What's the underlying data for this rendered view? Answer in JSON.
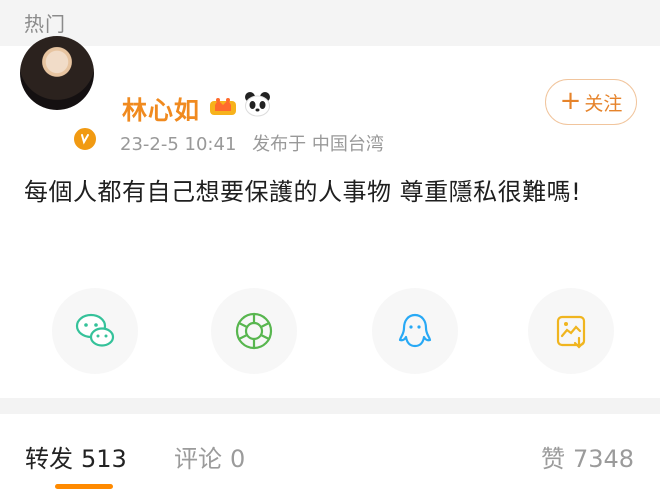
{
  "top": {
    "title": "热门"
  },
  "post": {
    "username": "林心如",
    "date": "23-2-5 10:41",
    "location": "发布于 中国台湾",
    "text": "每個人都有自己想要保護的人事物 尊重隱私很難嗎!",
    "follow_label": "关注"
  },
  "share_icons": [
    "wechat-icon",
    "moments-icon",
    "qq-icon",
    "save-image-icon"
  ],
  "stats": {
    "repost_label": "转发",
    "repost_count": "513",
    "comment_label": "评论",
    "comment_count": "0",
    "like_label": "赞",
    "like_count": "7348"
  },
  "colors": {
    "accent": "#f08a1f",
    "active_underline": "#ff8a00",
    "wechat": "#35c29a",
    "qq": "#28a9f5",
    "save": "#f0b51f"
  }
}
